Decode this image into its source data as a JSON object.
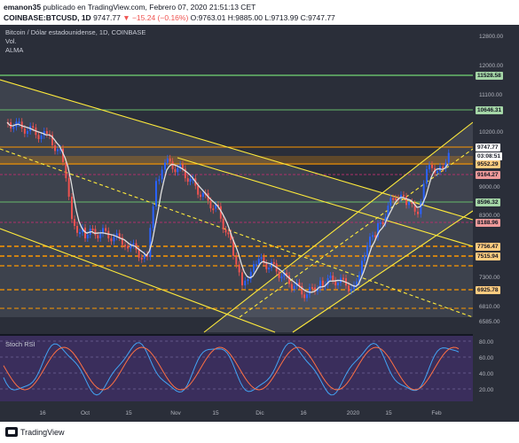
{
  "header": {
    "line1_author": "emanon35",
    "line1_rest": "publicado en TradingView.com, Febrero 07, 2020 21:51:13 CET",
    "symbol": "COINBASE:BTCUSD, 1D",
    "last": "9747.77",
    "change": "▼ −15.24 (−0.16%)",
    "o": "O:9763.01",
    "h": "H:9885.00",
    "l": "L:9713.99",
    "c": "C:9747.77"
  },
  "legend": {
    "title": "Bitcoin / Dólar estadounidense, 1D, COINBASE",
    "vol": "Vol.",
    "alma": "ALMA"
  },
  "rsi_label": "Stoch RSI",
  "price_axis": [
    "12800.00",
    "12000.00",
    "11100.00",
    "10200.00",
    "9000.00",
    "8300.00",
    "7300.00",
    "6810.00",
    "6585.00"
  ],
  "rsi_axis": [
    "80.00",
    "60.00",
    "40.00",
    "20.00"
  ],
  "time_axis": [
    "16",
    "Oct",
    "15",
    "Nov",
    "15",
    "Dic",
    "16",
    "2020",
    "15",
    "Feb"
  ],
  "price_tags": [
    {
      "label": "11528.58",
      "color": "#a5d6a7"
    },
    {
      "label": "10646.31",
      "color": "#a5d6a7"
    },
    {
      "label": "9747.77",
      "color": "#ffffff"
    },
    {
      "label": "03:08:51",
      "color": "#ffffff"
    },
    {
      "label": "9552.29",
      "color": "#ffcc80"
    },
    {
      "label": "9164.27",
      "color": "#ef9a9a"
    },
    {
      "label": "8596.32",
      "color": "#a5d6a7"
    },
    {
      "label": "8188.96",
      "color": "#ef9a9a"
    },
    {
      "label": "7756.47",
      "color": "#ffcc80"
    },
    {
      "label": "7515.94",
      "color": "#ffcc80"
    },
    {
      "label": "6925.78",
      "color": "#ffcc80"
    }
  ],
  "footer": {
    "brand": "TradingView"
  },
  "colors": {
    "up": "#2962ff",
    "down": "#ef5350",
    "trend": "#ffeb3b",
    "green": "#66bb6a",
    "orange": "#ff9800",
    "magenta": "#b0306a"
  }
}
